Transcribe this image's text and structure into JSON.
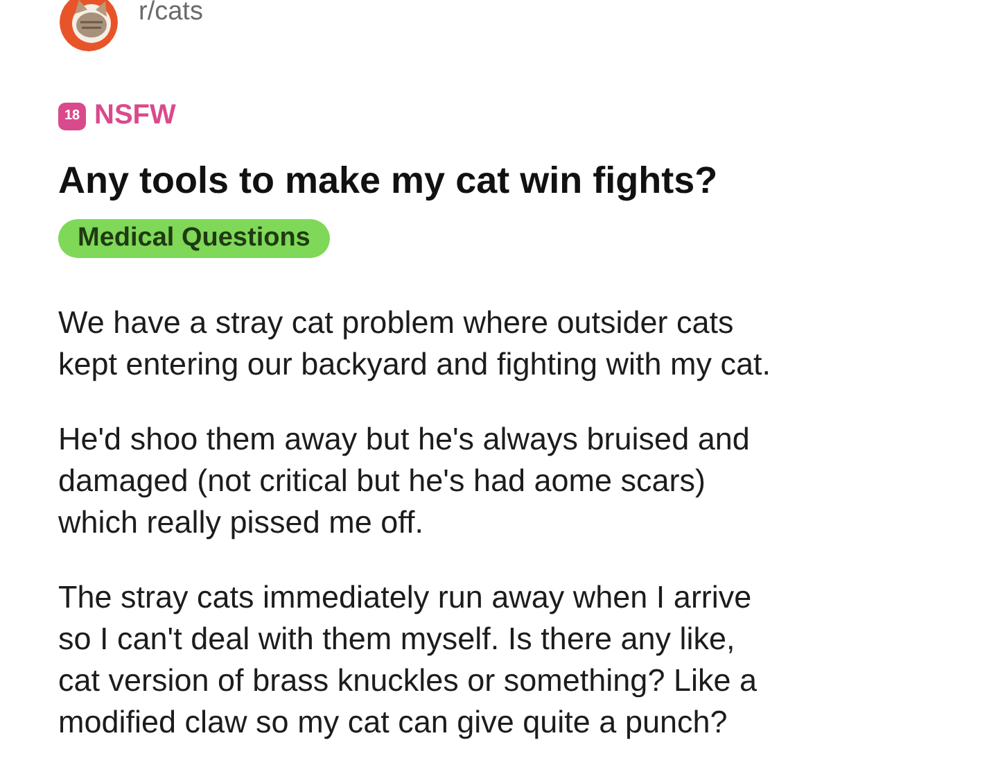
{
  "subreddit": {
    "name": "r/cats"
  },
  "nsfw": {
    "badge": "18",
    "label": "NSFW"
  },
  "post": {
    "title": "Any tools to make my cat win fights?",
    "flair": {
      "label": "Medical Questions",
      "color": "#7fd858"
    },
    "paragraphs": [
      {
        "lines": [
          "We have a stray cat problem where outsider cats",
          "kept entering our backyard and fighting with my cat."
        ]
      },
      {
        "lines": [
          "He'd shoo them away but he's always bruised and",
          "damaged (not critical but he's had aome scars)",
          "which really pissed me off."
        ]
      },
      {
        "lines": [
          "The stray cats immediately run away when I arrive",
          "so I can't deal with them myself. Is there any like,",
          "cat version of brass knuckles or something? Like a",
          "modified claw so my cat can give quite a punch?"
        ]
      }
    ]
  }
}
